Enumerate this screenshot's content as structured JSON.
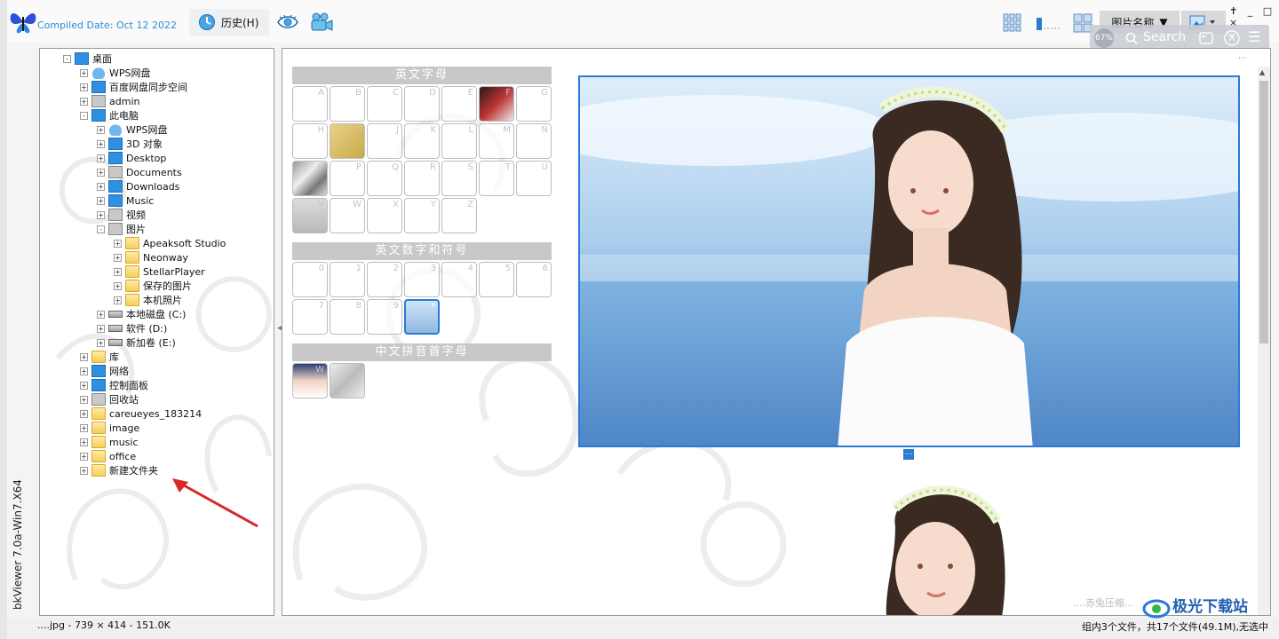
{
  "app": {
    "vertical_title": "bkViewer 7.0a-Win7.X64",
    "compiled_date": "Compiled Date: Oct 12 2022"
  },
  "toolbar": {
    "history_label": "历史(H)",
    "sort_label": "图片名称",
    "search_placeholder": "Search",
    "zoom_badge": "67%",
    "window_controls": "✝ _ □ ×"
  },
  "tree": {
    "items": [
      {
        "label": "桌面",
        "icon": "desktop-icon",
        "level": 0,
        "state": "-"
      },
      {
        "label": "WPS网盘",
        "icon": "cloud-icon",
        "level": 1,
        "state": "+"
      },
      {
        "label": "百度网盘同步空间",
        "icon": "baidu-icon",
        "level": 1,
        "state": "+"
      },
      {
        "label": "admin",
        "icon": "user-icon",
        "level": 1,
        "state": "+"
      },
      {
        "label": "此电脑",
        "icon": "computer-icon",
        "level": 1,
        "state": "-"
      },
      {
        "label": "WPS网盘",
        "icon": "cloud-icon",
        "level": 2,
        "state": "+"
      },
      {
        "label": "3D 对象",
        "icon": "cube-icon",
        "level": 2,
        "state": "+"
      },
      {
        "label": "Desktop",
        "icon": "desktop-icon",
        "level": 2,
        "state": "+"
      },
      {
        "label": "Documents",
        "icon": "document-icon",
        "level": 2,
        "state": "+"
      },
      {
        "label": "Downloads",
        "icon": "download-icon",
        "level": 2,
        "state": "+"
      },
      {
        "label": "Music",
        "icon": "music-icon",
        "level": 2,
        "state": "+"
      },
      {
        "label": "视频",
        "icon": "video-icon",
        "level": 2,
        "state": "+"
      },
      {
        "label": "图片",
        "icon": "picture-icon",
        "level": 2,
        "state": "-"
      },
      {
        "label": "Apeaksoft Studio",
        "icon": "folder-icon",
        "level": 3,
        "state": "+"
      },
      {
        "label": "Neonway",
        "icon": "folder-icon",
        "level": 3,
        "state": "+"
      },
      {
        "label": "StellarPlayer",
        "icon": "folder-icon",
        "level": 3,
        "state": "+"
      },
      {
        "label": "保存的图片",
        "icon": "folder-icon",
        "level": 3,
        "state": "+"
      },
      {
        "label": "本机照片",
        "icon": "folder-icon",
        "level": 3,
        "state": "+"
      },
      {
        "label": "本地磁盘 (C:)",
        "icon": "drive-icon",
        "level": 2,
        "state": "+"
      },
      {
        "label": "软件 (D:)",
        "icon": "drive-icon",
        "level": 2,
        "state": "+"
      },
      {
        "label": "新加卷 (E:)",
        "icon": "drive-icon",
        "level": 2,
        "state": "+"
      },
      {
        "label": "库",
        "icon": "library-icon",
        "level": 1,
        "state": "+"
      },
      {
        "label": "网络",
        "icon": "network-icon",
        "level": 1,
        "state": "+"
      },
      {
        "label": "控制面板",
        "icon": "control-panel-icon",
        "level": 1,
        "state": "+"
      },
      {
        "label": "回收站",
        "icon": "recycle-bin-icon",
        "level": 1,
        "state": "+"
      },
      {
        "label": "careueyes_183214",
        "icon": "folder-icon",
        "level": 1,
        "state": "+"
      },
      {
        "label": "image",
        "icon": "folder-icon",
        "level": 1,
        "state": "+"
      },
      {
        "label": "music",
        "icon": "folder-icon",
        "level": 1,
        "state": "+"
      },
      {
        "label": "office",
        "icon": "folder-icon",
        "level": 1,
        "state": "+"
      },
      {
        "label": "新建文件夹",
        "icon": "folder-icon",
        "level": 1,
        "state": "+"
      }
    ]
  },
  "groups": {
    "letters": {
      "title": "英文字母",
      "cells": [
        "A",
        "B",
        "C",
        "D",
        "E",
        "F",
        "G",
        "H",
        "I",
        "J",
        "K",
        "L",
        "M",
        "N",
        "O",
        "P",
        "Q",
        "R",
        "S",
        "T",
        "U",
        "V",
        "W",
        "X",
        "Y",
        "Z"
      ]
    },
    "digits": {
      "title": "英文数字和符号",
      "cells": [
        "0",
        "1",
        "2",
        "3",
        "4",
        "5",
        "6",
        "7",
        "8",
        "9",
        "*"
      ]
    },
    "pinyin": {
      "title": "中文拼音首字母",
      "cells": [
        "W",
        ""
      ]
    }
  },
  "main": {
    "watermark": "....赤兔压缩...",
    "preview_dots": "..."
  },
  "status": {
    "left": "....jpg - 739 × 414 - 151.0K",
    "right": "组内3个文件，共17个文件(49.1M),无选中"
  },
  "site_logo": "极光下载站"
}
